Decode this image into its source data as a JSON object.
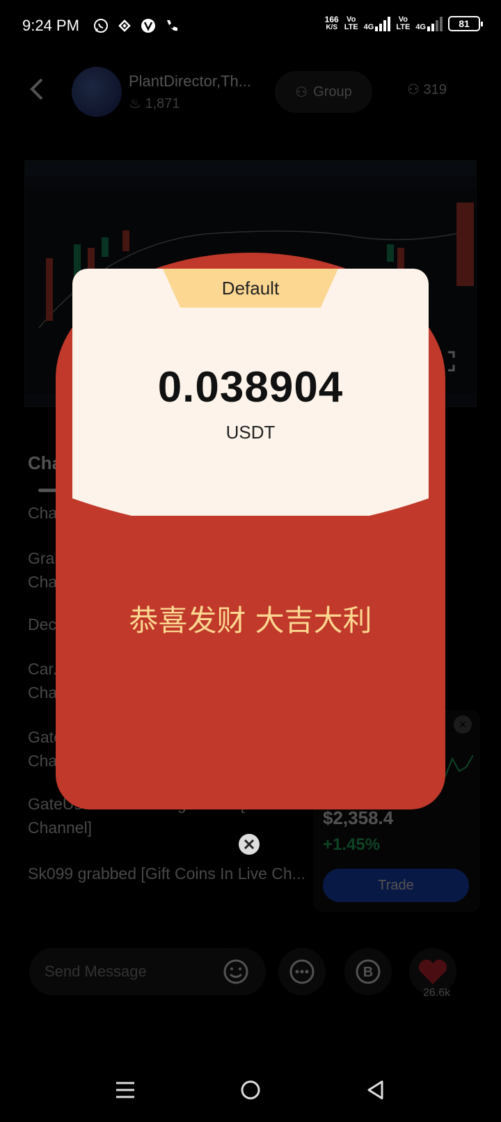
{
  "status_bar": {
    "time": "9:24 PM",
    "speed_value": "166",
    "speed_unit": "K/S",
    "volte_1": "Vo\nLTE",
    "net_1": "4G",
    "volte_2": "Vo\nLTE",
    "net_2": "4G",
    "battery": "81",
    "icons": [
      "whatsapp-icon",
      "binance-icon",
      "vpn-icon",
      "phone-icon"
    ]
  },
  "header": {
    "channel_name": "PlantDirector,Th...",
    "fire_count": "1,871",
    "group_label": "Group",
    "member_count": "319"
  },
  "chat": {
    "tab_label": "Cha",
    "lines": [
      "Cha",
      "Grab...\nCha...",
      "Dec...",
      "Car...\nCha...",
      "Gate...\nCha...",
      "GateUser-50287ba5 grabbed [Gift C...\nChannel]",
      "Sk099 grabbed [Gift Coins In Live Ch..."
    ]
  },
  "price_card": {
    "price": "$2,358.4",
    "change": "+1.45%",
    "trade_label": "Trade",
    "change_color": "#2ecc71"
  },
  "bottom_bar": {
    "message_placeholder": "Send Message",
    "like_count": "26.6k"
  },
  "red_packet": {
    "tag": "Default",
    "amount": "0.038904",
    "currency": "USDT",
    "blessing": "恭喜发财 大吉大利",
    "packet_color": "#c0392b",
    "accent_color": "#fcd791"
  }
}
